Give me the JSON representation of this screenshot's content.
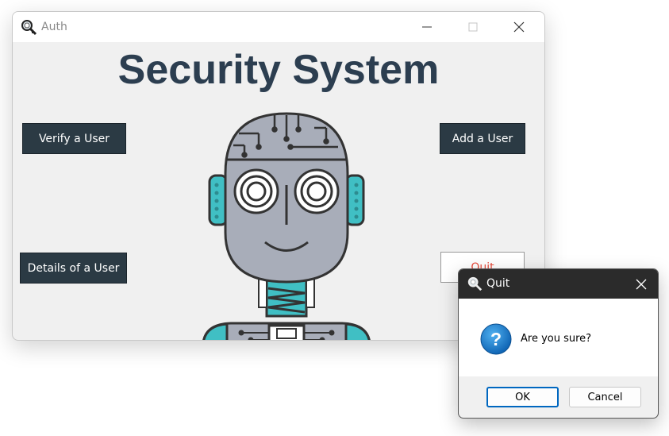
{
  "main_window": {
    "title": "Auth",
    "heading": "Security System",
    "buttons": {
      "verify": "Verify a User",
      "add": "Add a User",
      "details": "Details of a User",
      "quit": "Quit"
    }
  },
  "dialog": {
    "title": "Quit",
    "message": "Are you sure?",
    "ok": "OK",
    "cancel": "Cancel"
  },
  "colors": {
    "button_dark": "#2b3a44",
    "heading": "#2c3e50",
    "quit_text": "#e74c3c",
    "robot_gray": "#a8adb9",
    "robot_teal": "#40bfc4",
    "dialog_title_bg": "#2b2b2b",
    "ok_border": "#0067c0"
  },
  "icons": {
    "app": "magnifier-key-icon",
    "question": "question-icon"
  }
}
